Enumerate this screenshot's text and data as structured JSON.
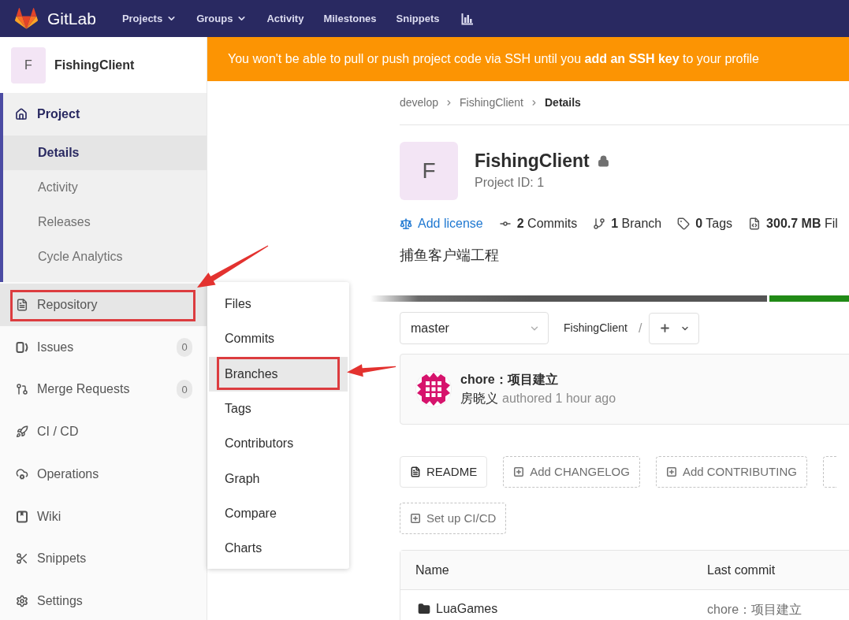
{
  "navbar": {
    "brand": "GitLab",
    "items": [
      {
        "label": "Projects",
        "dropdown": true
      },
      {
        "label": "Groups",
        "dropdown": true
      },
      {
        "label": "Activity",
        "dropdown": false
      },
      {
        "label": "Milestones",
        "dropdown": false
      },
      {
        "label": "Snippets",
        "dropdown": false
      }
    ]
  },
  "sidebar": {
    "project": {
      "avatar": "F",
      "name": "FishingClient"
    },
    "items": [
      {
        "label": "Project",
        "selected": true,
        "hovered": false,
        "annotated": false,
        "children": [
          {
            "label": "Details",
            "selected": true
          },
          {
            "label": "Activity",
            "selected": false
          },
          {
            "label": "Releases",
            "selected": false
          },
          {
            "label": "Cycle Analytics",
            "selected": false
          }
        ]
      },
      {
        "label": "Repository",
        "selected": false,
        "hovered": true,
        "annotated": true,
        "flyout": [
          {
            "label": "Files",
            "hovered": false,
            "annotated": false
          },
          {
            "label": "Commits",
            "hovered": false,
            "annotated": false
          },
          {
            "label": "Branches",
            "hovered": true,
            "annotated": true
          },
          {
            "label": "Tags",
            "hovered": false,
            "annotated": false
          },
          {
            "label": "Contributors",
            "hovered": false,
            "annotated": false
          },
          {
            "label": "Graph",
            "hovered": false,
            "annotated": false
          },
          {
            "label": "Compare",
            "hovered": false,
            "annotated": false
          },
          {
            "label": "Charts",
            "hovered": false,
            "annotated": false
          }
        ]
      },
      {
        "label": "Issues",
        "selected": false,
        "hovered": false,
        "annotated": false,
        "count": "0"
      },
      {
        "label": "Merge Requests",
        "selected": false,
        "hovered": false,
        "annotated": false,
        "count": "0"
      },
      {
        "label": "CI / CD",
        "selected": false,
        "hovered": false,
        "annotated": false
      },
      {
        "label": "Operations",
        "selected": false,
        "hovered": false,
        "annotated": false
      },
      {
        "label": "Wiki",
        "selected": false,
        "hovered": false,
        "annotated": false
      },
      {
        "label": "Snippets",
        "selected": false,
        "hovered": false,
        "annotated": false
      },
      {
        "label": "Settings",
        "selected": false,
        "hovered": false,
        "annotated": false
      }
    ]
  },
  "banner": {
    "before": "You won't be able to pull or push project code via SSH until you",
    "link": "add an SSH key",
    "after": "to your profile"
  },
  "breadcrumb": [
    {
      "label": "develop",
      "current": false
    },
    {
      "label": "FishingClient",
      "current": false
    },
    {
      "label": "Details",
      "current": true
    }
  ],
  "project": {
    "avatar": "F",
    "name": "FishingClient",
    "private": true,
    "id": "Project ID: 1",
    "stats": [
      {
        "kind": "link",
        "text": "Add license"
      },
      {
        "kind": "count",
        "text": "**2** Commits"
      },
      {
        "kind": "count",
        "text": "**1** Branch"
      },
      {
        "kind": "count",
        "text": "**0** Tags"
      },
      {
        "kind": "count",
        "text": "**300.7 MB** Fil"
      }
    ],
    "description": "捕鱼客户端工程"
  },
  "tree_controls": {
    "branch": "master",
    "path_root": "FishingClient",
    "separator": "/"
  },
  "last_commit": {
    "title": "chore：项目建立",
    "author": "房晓义",
    "meta": "authored 1 hour ago"
  },
  "file_button_rows": [
    {
      "buttons": [
        {
          "kind": "existing",
          "label": "README"
        },
        {
          "kind": "add",
          "label": "Add CHANGELOG"
        },
        {
          "kind": "add",
          "label": "Add CONTRIBUTING"
        },
        {
          "kind": "add"
        }
      ]
    },
    {
      "buttons": [
        {
          "kind": "add",
          "label": "Set up CI/CD"
        }
      ]
    }
  ],
  "files_table": {
    "columns": [
      "Name",
      "Last commit"
    ],
    "rows": [
      {
        "kind": "folder",
        "name": "LuaGames",
        "last_commit": "chore：项目建立"
      }
    ]
  }
}
